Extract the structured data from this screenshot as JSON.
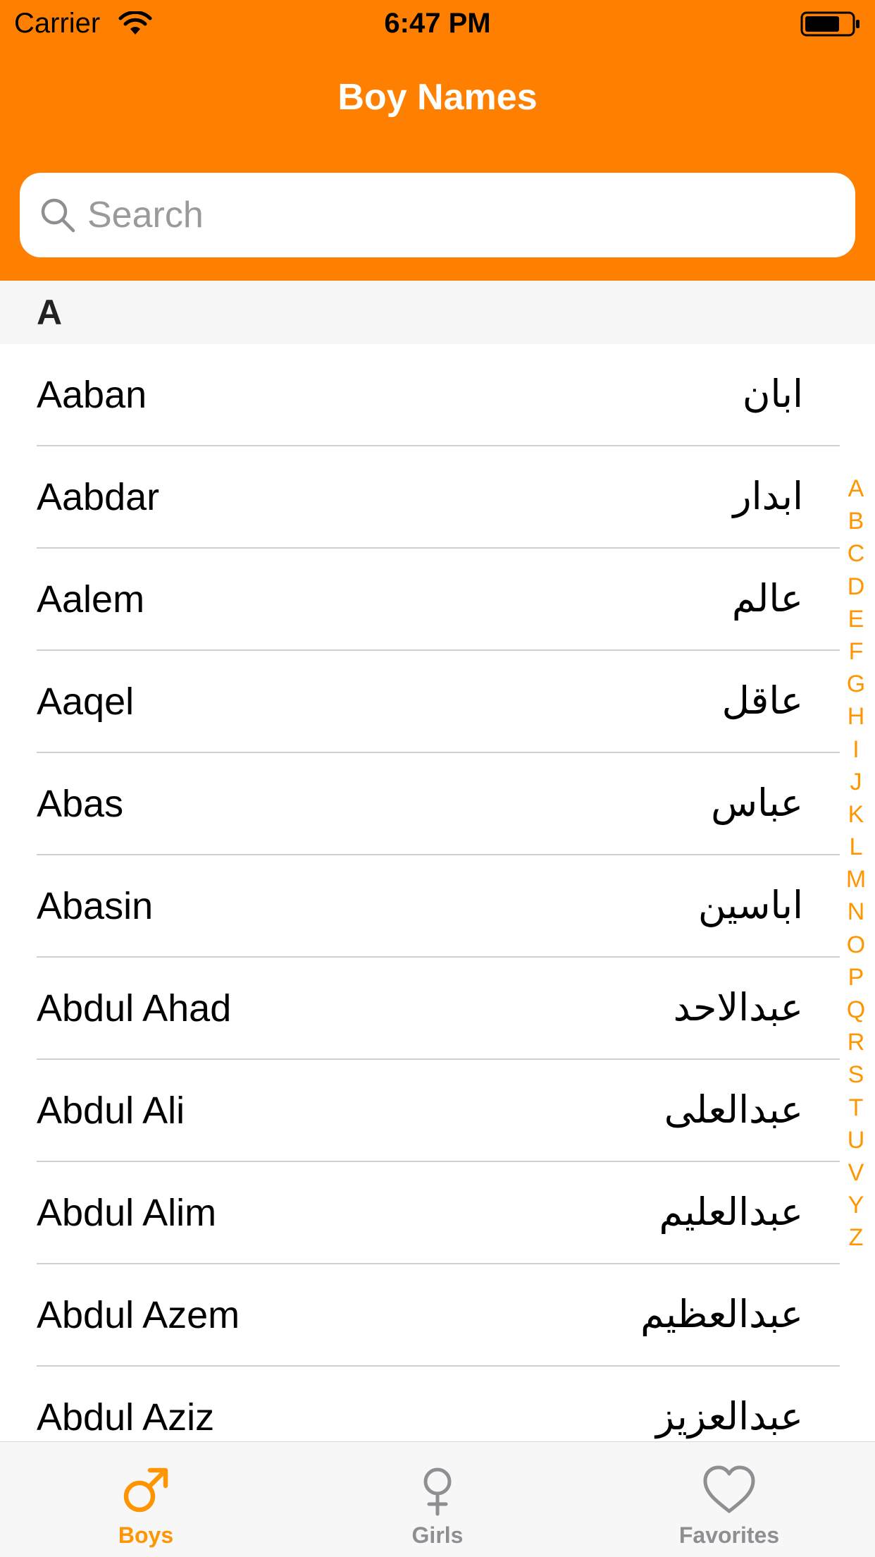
{
  "status_bar": {
    "carrier": "Carrier",
    "time": "6:47 PM",
    "wifi_icon": "wifi-icon",
    "battery_icon": "battery-icon"
  },
  "nav": {
    "title": "Boy Names"
  },
  "search": {
    "placeholder": "Search",
    "value": "",
    "icon": "search-icon"
  },
  "section": {
    "header": "A"
  },
  "names": [
    {
      "english": "Aaban",
      "arabic": "ابان"
    },
    {
      "english": "Aabdar",
      "arabic": "ابدار"
    },
    {
      "english": "Aalem",
      "arabic": "عالم"
    },
    {
      "english": "Aaqel",
      "arabic": "عاقل"
    },
    {
      "english": "Abas",
      "arabic": "عباس"
    },
    {
      "english": "Abasin",
      "arabic": "اباسين"
    },
    {
      "english": "Abdul Ahad",
      "arabic": "عبدالاحد"
    },
    {
      "english": "Abdul Ali",
      "arabic": "عبدالعلى"
    },
    {
      "english": "Abdul Alim",
      "arabic": "عبدالعليم"
    },
    {
      "english": "Abdul Azem",
      "arabic": "عبدالعظيم"
    },
    {
      "english": "Abdul Aziz",
      "arabic": "عبدالعزيز"
    }
  ],
  "index_letters": [
    "A",
    "B",
    "C",
    "D",
    "E",
    "F",
    "G",
    "H",
    "I",
    "J",
    "K",
    "L",
    "M",
    "N",
    "O",
    "P",
    "Q",
    "R",
    "S",
    "T",
    "U",
    "V",
    "Y",
    "Z"
  ],
  "tabs": [
    {
      "label": "Boys",
      "icon": "male-symbol-icon",
      "selected": true
    },
    {
      "label": "Girls",
      "icon": "female-symbol-icon",
      "selected": false
    },
    {
      "label": "Favorites",
      "icon": "heart-icon",
      "selected": false
    }
  ],
  "colors": {
    "accent": "#FF8000",
    "index_accent": "#FF9500",
    "tab_active": "#FF9500",
    "tab_inactive": "#8E8E93"
  }
}
